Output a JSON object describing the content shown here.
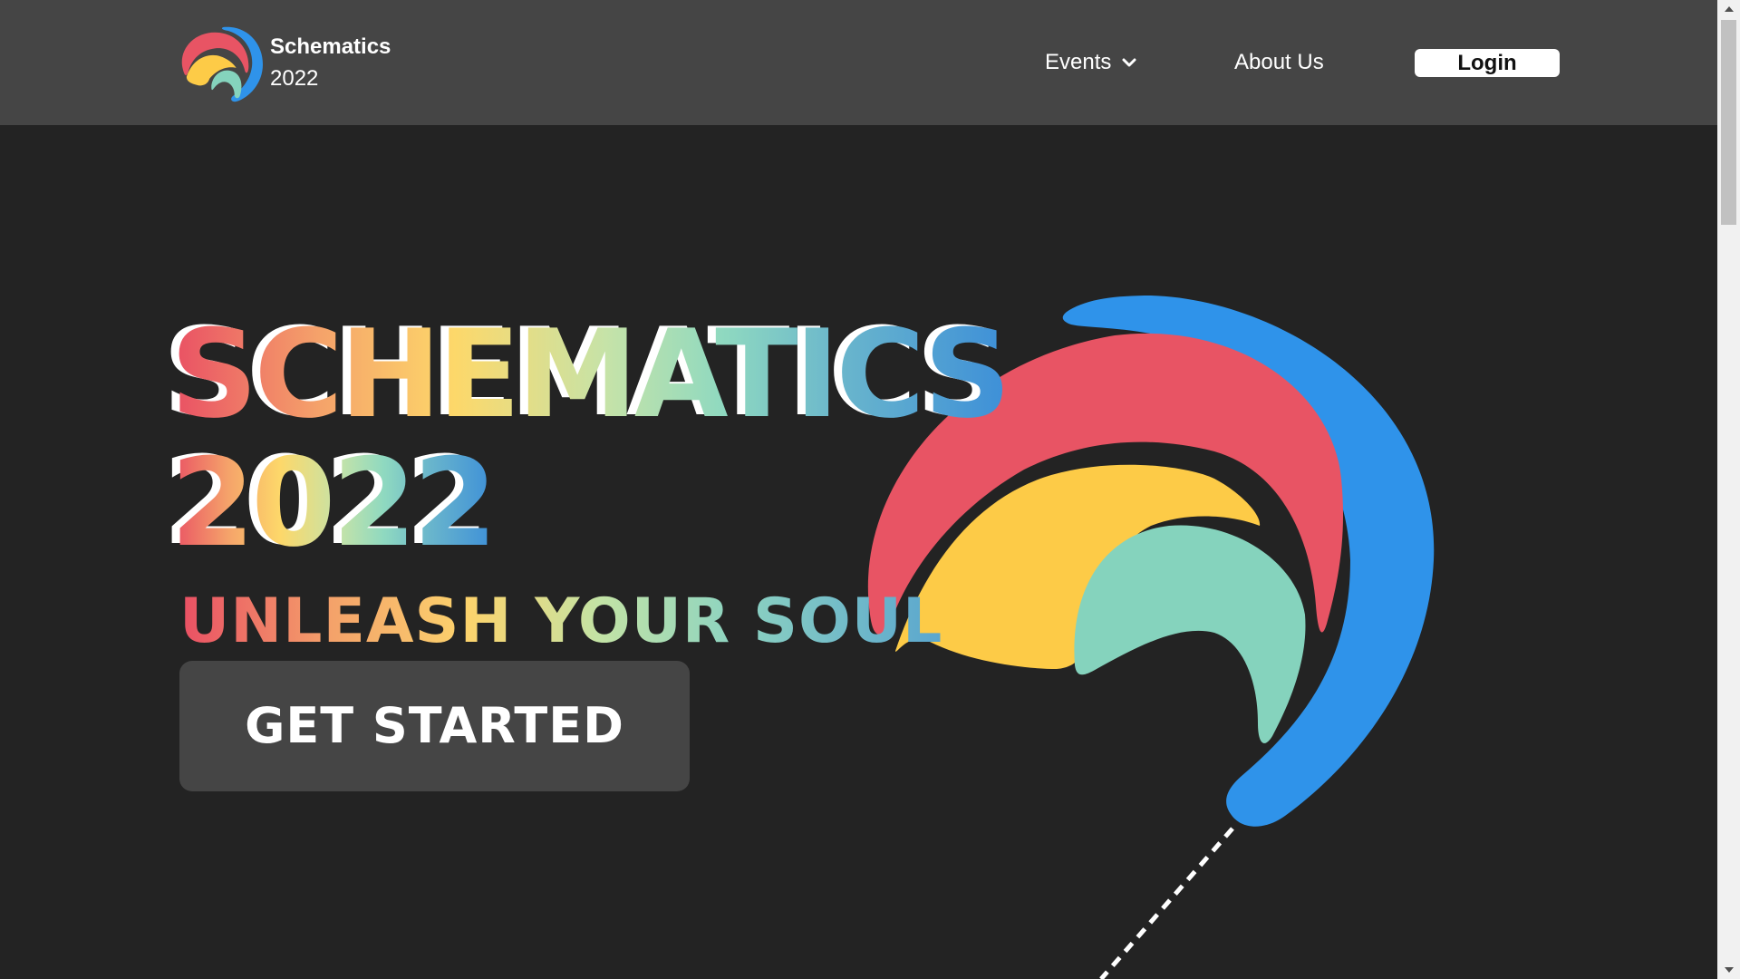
{
  "header": {
    "brand_name": "Schematics",
    "brand_year": "2022",
    "nav": {
      "events_label": "Events",
      "about_label": "About Us",
      "login_label": "Login"
    }
  },
  "hero": {
    "title_line1": "SCHEMATICS",
    "title_line2": "2022",
    "tagline": "UNLEASH YOUR SOUL",
    "cta_label": "GET STARTED"
  },
  "colors": {
    "background": "#232323",
    "header": "#454545",
    "logo_red": "#e85464",
    "logo_yellow": "#fdcb47",
    "logo_teal": "#85d3bd",
    "logo_blue": "#2f93ea"
  },
  "icons": {
    "events_dropdown": "chevron-down-icon",
    "brand": "schematics-logo",
    "scroll_up": "arrow-up-icon",
    "scroll_down": "arrow-down-icon"
  }
}
